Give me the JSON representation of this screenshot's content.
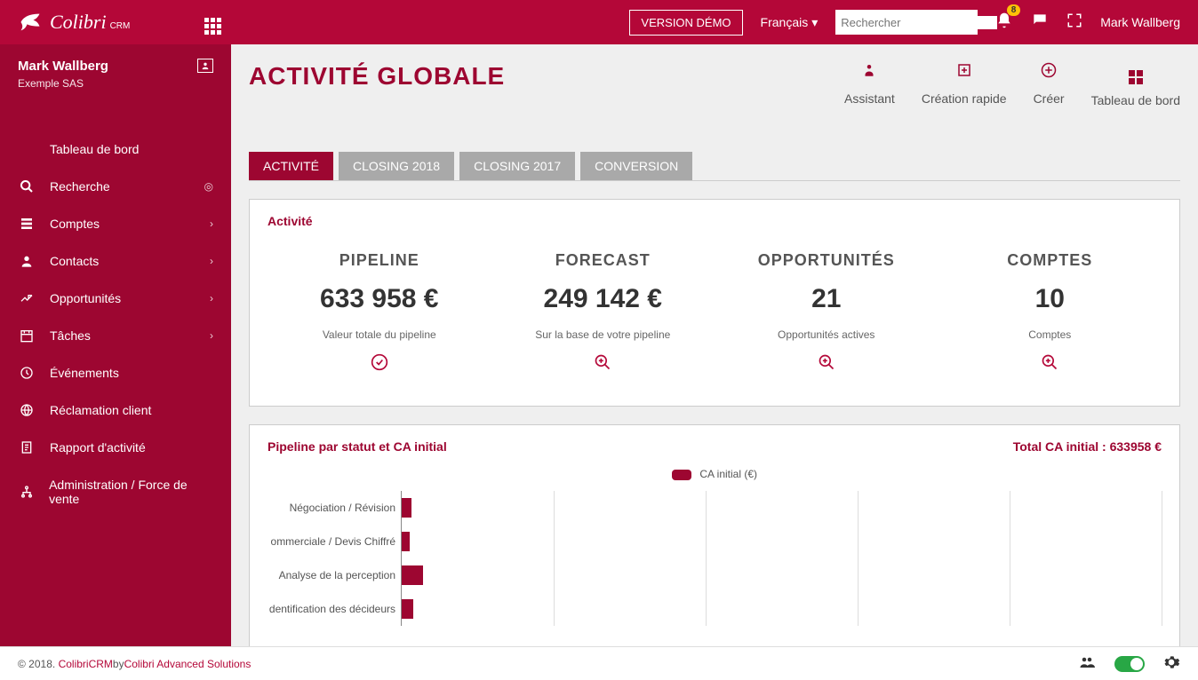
{
  "topbar": {
    "brand": "Colibri",
    "brand_sub": "CRM",
    "version_btn": "VERSION DÉMO",
    "language": "Français",
    "search_placeholder": "Rechercher",
    "notification_count": "8",
    "user": "Mark Wallberg"
  },
  "sidebar": {
    "user": "Mark Wallberg",
    "org": "Exemple SAS",
    "items": [
      {
        "label": "Tableau de bord",
        "icon": "dashboard",
        "ext": ""
      },
      {
        "label": "Recherche",
        "icon": "search",
        "ext": "target"
      },
      {
        "label": "Comptes",
        "icon": "accounts",
        "ext": "chev"
      },
      {
        "label": "Contacts",
        "icon": "contacts",
        "ext": "chev"
      },
      {
        "label": "Opportunités",
        "icon": "opps",
        "ext": "chev"
      },
      {
        "label": "Tâches",
        "icon": "tasks",
        "ext": "chev"
      },
      {
        "label": "Événements",
        "icon": "events",
        "ext": ""
      },
      {
        "label": "Réclamation client",
        "icon": "claim",
        "ext": ""
      },
      {
        "label": "Rapport d'activité",
        "icon": "report",
        "ext": ""
      },
      {
        "label": "Administration / Force de vente",
        "icon": "admin",
        "ext": ""
      }
    ]
  },
  "page": {
    "title": "ACTIVITÉ GLOBALE",
    "actions": [
      {
        "label": "Assistant",
        "icon": "assistant"
      },
      {
        "label": "Création rapide",
        "icon": "quick"
      },
      {
        "label": "Créer",
        "icon": "plus"
      },
      {
        "label": "Tableau de bord",
        "icon": "dash"
      }
    ],
    "tabs": [
      "ACTIVITÉ",
      "CLOSING 2018",
      "CLOSING 2017",
      "CONVERSION"
    ],
    "active_tab": 0
  },
  "kpi_panel": {
    "title": "Activité",
    "items": [
      {
        "label": "PIPELINE",
        "value": "633 958 €",
        "sub": "Valeur totale du pipeline",
        "icon": "check"
      },
      {
        "label": "FORECAST",
        "value": "249 142 €",
        "sub": "Sur la base de votre pipeline",
        "icon": "zoom"
      },
      {
        "label": "OPPORTUNITÉS",
        "value": "21",
        "sub": "Opportunités actives",
        "icon": "zoom"
      },
      {
        "label": "COMPTES",
        "value": "10",
        "sub": "Comptes",
        "icon": "zoom"
      }
    ]
  },
  "chart_panel": {
    "title": "Pipeline par statut et CA initial",
    "total_label": "Total CA initial : 633958 €",
    "legend": "CA initial (€)"
  },
  "chart_data": {
    "type": "bar",
    "orientation": "horizontal",
    "title": "Pipeline par statut et CA initial",
    "xlabel": "CA initial (€)",
    "ylabel": "",
    "categories": [
      "Négociation / Révision",
      "Proposition Commerciale / Devis Chiffré",
      "Analyse de la perception",
      "Identification des décideurs"
    ],
    "categories_truncated": [
      "Négociation / Révision",
      "ommerciale / Devis Chiffré",
      "Analyse de la perception",
      "dentification des décideurs"
    ],
    "values": [
      10000,
      8000,
      22000,
      12000
    ],
    "series": [
      {
        "name": "CA initial (€)",
        "color": "#9d0631"
      }
    ],
    "xlim": [
      0,
      800000
    ],
    "total": 633958
  },
  "footer": {
    "year": "© 2018.",
    "link1": "ColibriCRM",
    "by": " by ",
    "link2": "Colibri Advanced Solutions"
  }
}
